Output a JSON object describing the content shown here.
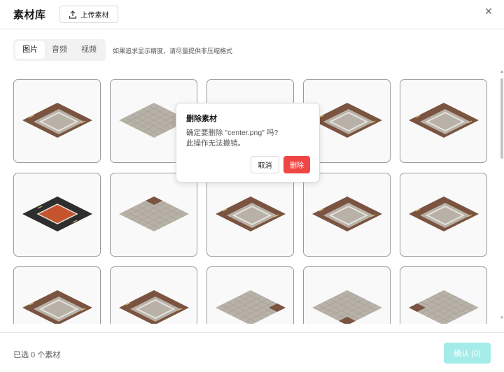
{
  "header": {
    "title": "素材库",
    "upload_label": "上传素材",
    "close_glyph": "✕"
  },
  "tabs": [
    {
      "label": "图片",
      "active": true
    },
    {
      "label": "音频",
      "active": false
    },
    {
      "label": "视频",
      "active": false
    }
  ],
  "hint": "如果追求显示精度，请尽量提供非压缩格式",
  "tiles": [
    {
      "variant": "bottom-left-road"
    },
    {
      "variant": "plain"
    },
    {
      "variant": "plain"
    },
    {
      "variant": "bottom-right-road"
    },
    {
      "variant": "center-road"
    },
    {
      "variant": "dark-red"
    },
    {
      "variant": "top-corner"
    },
    {
      "variant": "left-road"
    },
    {
      "variant": "center-road"
    },
    {
      "variant": "right-road"
    },
    {
      "variant": "bottom-left-road"
    },
    {
      "variant": "bottom-road"
    },
    {
      "variant": "plain-right"
    },
    {
      "variant": "bottom-corner"
    },
    {
      "variant": "left-corner"
    }
  ],
  "popover": {
    "title": "删除素材",
    "message_line1": "确定要删除 \"center.png\" 吗?",
    "message_line2": "此操作无法撤销。",
    "cancel_label": "取消",
    "delete_label": "删除"
  },
  "footer": {
    "selected_text": "已选 0 个素材",
    "confirm_label": "确认 (0)"
  },
  "colors": {
    "confirm_bg": "#a4ecea",
    "delete_bg": "#ef4545",
    "stone": "#b8b1a8",
    "dirt": "#7a5440"
  }
}
